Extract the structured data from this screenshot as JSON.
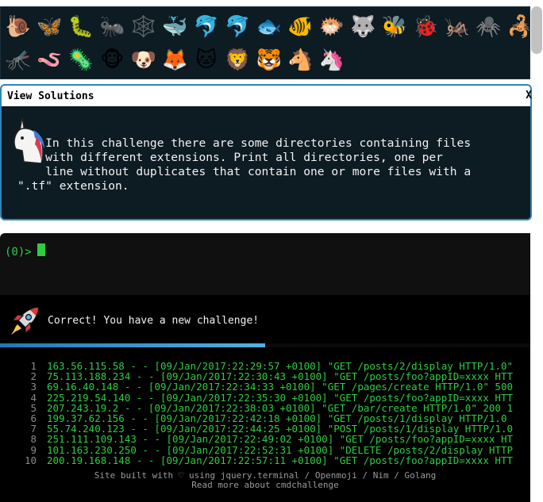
{
  "emoji_grid": {
    "row1": [
      "🐌",
      "🦋",
      "🐛",
      "🐜",
      "🕸️",
      "🐳",
      "🐬",
      "🐬",
      "🐟",
      "🐠",
      "🐡",
      "🐺",
      "🐝",
      "🐞",
      "🦗",
      "🕷️",
      "🦂"
    ],
    "row2": [
      "🦟",
      "🪱",
      "🦠",
      "🐵",
      "🐶",
      "🦊",
      "🐱",
      "🦁",
      "🐯",
      "🐴",
      "🦄"
    ]
  },
  "solutions_panel": {
    "title": "View Solutions",
    "close": "X",
    "challenge_text": "    In this challenge there are some directories containing files\n    with different extensions. Print all directories, one per\n    line without duplicates that contain one or more files with a\n\".tf\" extension."
  },
  "terminal": {
    "prompt": "(0)>"
  },
  "status": {
    "message": "Correct! You have a new challenge!",
    "progress": 0.5
  },
  "log": [
    {
      "n": "1",
      "text": "163.56.115.58 - - [09/Jan/2017:22:29:57 +0100] \"GET /posts/2/display HTTP/1.0\""
    },
    {
      "n": "2",
      "text": "75.113.188.234 - - [09/Jan/2017:22:30:43 +0100] \"GET /posts/foo?appID=xxxx HTT"
    },
    {
      "n": "3",
      "text": "69.16.40.148 - - [09/Jan/2017:22:34:33 +0100] \"GET /pages/create HTTP/1.0\" 500"
    },
    {
      "n": "4",
      "text": "225.219.54.140 - - [09/Jan/2017:22:35:30 +0100] \"GET /posts/foo?appID=xxxx HTT"
    },
    {
      "n": "5",
      "text": "207.243.19.2 - - [09/Jan/2017:22:38:03 +0100] \"GET /bar/create HTTP/1.0\" 200 1"
    },
    {
      "n": "6",
      "text": "199.37.62.156 - - [09/Jan/2017:22:42:18 +0100] \"GET /posts/1/display HTTP/1.0"
    },
    {
      "n": "7",
      "text": "55.74.240.123 - - [09/Jan/2017:22:44:25 +0100] \"POST /posts/1/display HTTP/1.0"
    },
    {
      "n": "8",
      "text": "251.111.109.143 - - [09/Jan/2017:22:49:02 +0100] \"GET /posts/foo?appID=xxxx HT"
    },
    {
      "n": "9",
      "text": "101.163.230.250 - - [09/Jan/2017:22:52:31 +0100] \"DELETE /posts/2/display HTTP"
    },
    {
      "n": "10",
      "text": "200.19.168.148 - - [09/Jan/2017:22:57:11 +0100] \"GET /posts/foo?appID=xxxx HTT"
    }
  ],
  "footer": {
    "line1": "Site built with ♡ using jquery.terminal / Openmoji / Nim / Golang",
    "line2": "Read more about cmdchallenge"
  }
}
